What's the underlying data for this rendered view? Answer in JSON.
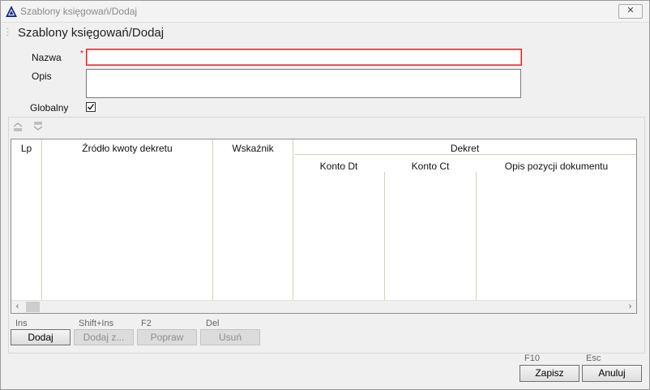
{
  "window": {
    "title": "Szablony księgowań/Dodaj",
    "close_glyph": "✕"
  },
  "header": {
    "title": "Szablony księgowań/Dodaj"
  },
  "form": {
    "name_label": "Nazwa",
    "name_required_mark": "*",
    "name_value": "",
    "description_label": "Opis",
    "description_value": "",
    "global_label": "Globalny",
    "global_checked": true
  },
  "toolbar": {
    "move_up_icon": "move-up-icon",
    "move_down_icon": "move-down-icon"
  },
  "grid": {
    "columns": {
      "lp": "Lp",
      "source": "Źródło kwoty dekretu",
      "indicator": "Wskaźnik",
      "group_decree": "Dekret",
      "account_dt": "Konto Dt",
      "account_ct": "Konto Ct",
      "document_position_desc": "Opis pozycji dokumentu"
    },
    "rows": []
  },
  "grid_buttons": [
    {
      "shortcut": "Ins",
      "label": "Dodaj",
      "enabled": true
    },
    {
      "shortcut": "Shift+Ins",
      "label": "Dodaj z...",
      "enabled": false
    },
    {
      "shortcut": "F2",
      "label": "Popraw",
      "enabled": false
    },
    {
      "shortcut": "Del",
      "label": "Usuń",
      "enabled": false
    }
  ],
  "footer": {
    "save_shortcut": "F10",
    "save_label": "Zapisz",
    "cancel_shortcut": "Esc",
    "cancel_label": "Anuluj"
  },
  "colors": {
    "required_border": "#e02020",
    "column_divider": "#d6d0b5"
  }
}
